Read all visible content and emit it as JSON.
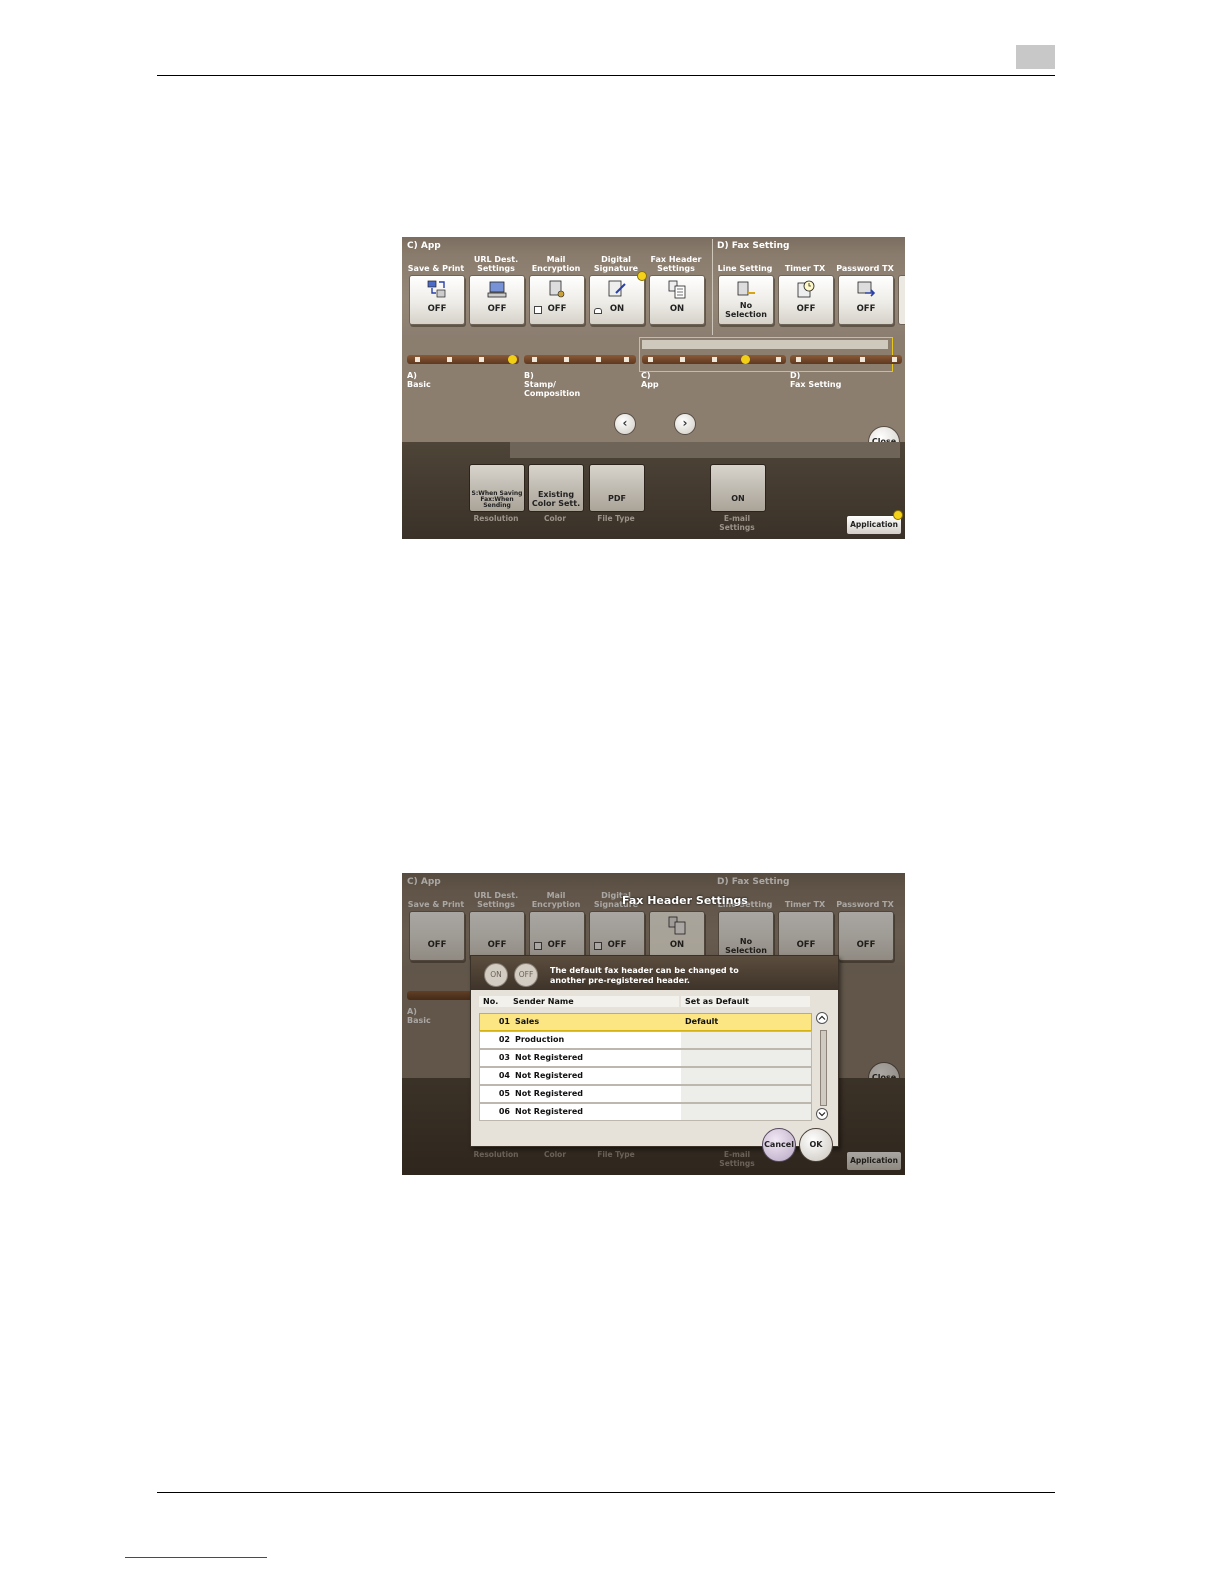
{
  "page": {
    "chapter_number": ""
  },
  "screen1": {
    "sections": {
      "app": "C)   App",
      "fax": "D)   Fax Setting"
    },
    "functions": [
      {
        "label": "Save & Print",
        "value": "OFF",
        "icon": "save-print-icon"
      },
      {
        "label": "URL Dest. Settings",
        "value": "OFF",
        "icon": "url-dest-icon"
      },
      {
        "label": "Mail Encryption",
        "value": "OFF",
        "icon": "mail-encryption-icon"
      },
      {
        "label": "Digital Signature",
        "value": "ON",
        "icon": "digital-signature-icon"
      },
      {
        "label": "Fax Header Settings",
        "value": "ON",
        "icon": "fax-header-icon"
      },
      {
        "label": "Line Setting",
        "value": "No Selection",
        "icon": "line-setting-icon"
      },
      {
        "label": "Timer TX",
        "value": "OFF",
        "icon": "timer-tx-icon"
      },
      {
        "label": "Password TX",
        "value": "OFF",
        "icon": "password-tx-icon"
      }
    ],
    "rail_labels": [
      {
        "letter": "A)",
        "name": "Basic"
      },
      {
        "letter": "B)",
        "name": "Stamp/ Composition"
      },
      {
        "letter": "C)",
        "name": "App"
      },
      {
        "letter": "D)",
        "name": "Fax Setting"
      }
    ],
    "nav": {
      "prev": "‹",
      "next": "›"
    },
    "close_label": "Close",
    "bottom_buttons": [
      {
        "value": "S:When Saving Fax:When Sending",
        "label": "Resolution"
      },
      {
        "value": "Existing Color Sett.",
        "label": "Color"
      },
      {
        "value": "PDF",
        "label": "File Type"
      },
      {
        "value": "ON",
        "label": "E-mail Settings"
      }
    ],
    "application_label": "Application"
  },
  "screen2": {
    "popup_title": "Fax Header Settings",
    "toggle_on": "ON",
    "toggle_off": "OFF",
    "message": "The default fax header can be changed to another pre-registered header.",
    "columns": {
      "no": "No.",
      "sender": "Sender Name",
      "default": "Set as Default"
    },
    "rows": [
      {
        "no": "01",
        "name": "Sales",
        "default": "Default"
      },
      {
        "no": "02",
        "name": "Production",
        "default": ""
      },
      {
        "no": "03",
        "name": "Not Registered",
        "default": ""
      },
      {
        "no": "04",
        "name": "Not Registered",
        "default": ""
      },
      {
        "no": "05",
        "name": "Not Registered",
        "default": ""
      },
      {
        "no": "06",
        "name": "Not Registered",
        "default": ""
      }
    ],
    "cancel_label": "Cancel",
    "ok_label": "OK",
    "close_label": "Close",
    "application_label": "Application"
  },
  "colors": {
    "panel": "#938576",
    "dark": "#3a3128",
    "accent": "#f3d219",
    "selected_row": "#fbe683"
  }
}
